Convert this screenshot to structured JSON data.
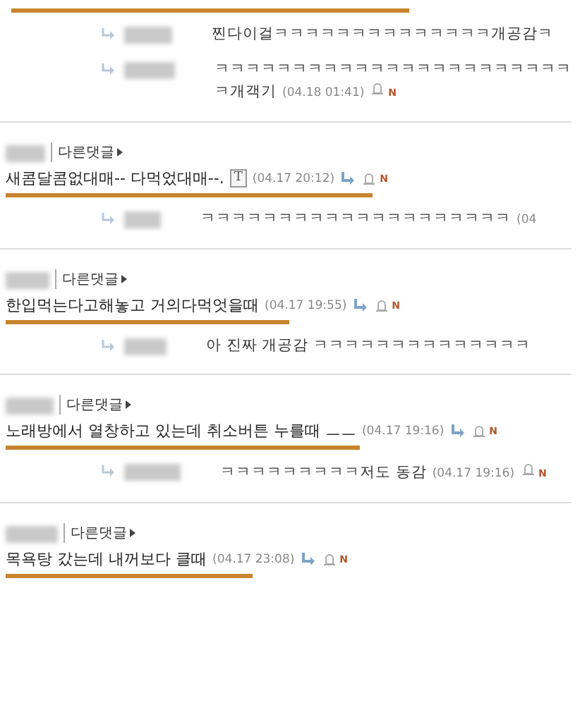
{
  "top_replies": [
    {
      "text": "찐다이걸ㅋㅋㅋㅋㅋㅋㅋㅋㅋㅋㅋㅋㅋㅋ개공감ㅋ"
    },
    {
      "text": "ㅋㅋㅋㅋㅋㅋㅋㅋㅋㅋㅋㅋㅋㅋㅋㅋㅋㅋㅋㅋㅋㅋㅋㅋ개객기",
      "time": "(04.18 01:41)",
      "badge": "N"
    }
  ],
  "comments": [
    {
      "other_link": "다른댓글",
      "text": "새콤달콤없대매-- 다먹었대매--.",
      "text_tag": "T",
      "time": "(04.17 20:12)",
      "badge": "N",
      "underlined": true,
      "replies": [
        {
          "text": "ㅋㅋㅋㅋㅋㅋㅋㅋㅋㅋㅋㅋㅋㅋㅋㅋㅋㅋㅋㅋ",
          "time": "(04"
        }
      ]
    },
    {
      "other_link": "다른댓글",
      "text": "한입먹는다고해놓고 거의다먹엇을때",
      "time": "(04.17 19:55)",
      "badge": "N",
      "underlined": true,
      "replies": [
        {
          "text": "아 진짜 개공감 ㅋㅋㅋㅋㅋㅋㅋㅋㅋㅋㅋㅋㅋㅋ"
        }
      ]
    },
    {
      "other_link": "다른댓글",
      "text": "노래방에서 열창하고 있는데 취소버튼 누를때 ㅡㅡ",
      "time": "(04.17 19:16)",
      "badge": "N",
      "underlined": true,
      "replies": [
        {
          "text": "ㅋㅋㅋㅋㅋㅋㅋㅋㅋ저도 동감",
          "time": "(04.17 19:16)",
          "badge": "N"
        }
      ]
    },
    {
      "other_link": "다른댓글",
      "text": "목욕탕 갔는데 내꺼보다 클때",
      "time": "(04.17 23:08)",
      "badge": "N",
      "underlined": true
    }
  ]
}
